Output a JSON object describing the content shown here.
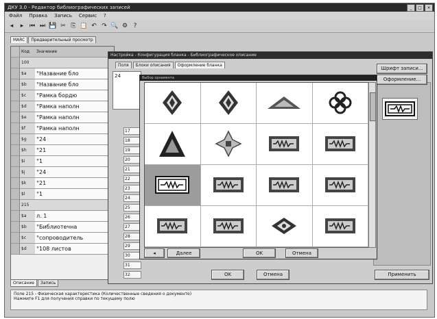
{
  "window": {
    "title": "ДКУ 3.0 - Редактор библиографических записей"
  },
  "menu": [
    "Файл",
    "Правка",
    "Запись",
    "Сервис",
    "?"
  ],
  "toolbar": [
    "◂",
    "▸",
    "⏮",
    "⏭",
    "💾",
    "✂",
    "⎘",
    "📋",
    "↶",
    "↷",
    "🔍",
    "⚙",
    "?"
  ],
  "main_tabs": [
    "MARC",
    "Предварительный просмотр"
  ],
  "grid": {
    "header": {
      "c1": "Код",
      "c2": "Значение"
    },
    "rows": [
      {
        "c1": "100",
        "c2": "",
        "section": true
      },
      {
        "c1": "$a",
        "c2": "°Название бло"
      },
      {
        "c1": "$b",
        "c2": "°Название бло"
      },
      {
        "c1": "$c",
        "c2": "°Рамка бордю"
      },
      {
        "c1": "$d",
        "c2": "°Рамка наполн"
      },
      {
        "c1": "$e",
        "c2": "°Рамка наполн"
      },
      {
        "c1": "$f",
        "c2": "°Рамка наполн"
      },
      {
        "c1": "$g",
        "c2": "°24"
      },
      {
        "c1": "$h",
        "c2": "°21"
      },
      {
        "c1": "$i",
        "c2": "°1"
      },
      {
        "c1": "$j",
        "c2": "°24"
      },
      {
        "c1": "$k",
        "c2": "°21"
      },
      {
        "c1": "$l",
        "c2": "°1"
      },
      {
        "c1": "215",
        "c2": "",
        "section": true
      },
      {
        "c1": "$a",
        "c2": "л. 1"
      },
      {
        "c1": "$b",
        "c2": "°Библиотечна"
      },
      {
        "c1": "$c",
        "c2": "°сопроводитель"
      },
      {
        "c1": "$d",
        "c2": "°108 листов"
      }
    ]
  },
  "bottom_tabs": [
    "Описание",
    "Запись"
  ],
  "status": {
    "line1": "Поле 215 - Физическая характеристика (Количественные сведения о документе)",
    "line2": "Нажмите F1 для получения справки по текущему полю"
  },
  "dialog_config": {
    "title": "Настройка - Конфигурация бланка - Библиографическое описание",
    "tabs": [
      "Поля",
      "Блоки описания",
      "Оформление бланка"
    ],
    "listbox_value": "24",
    "numbers": [
      "17",
      "18",
      "19",
      "20",
      "21",
      "22",
      "23",
      "24",
      "25",
      "26",
      "27",
      "28",
      "29",
      "30",
      "31",
      "32"
    ],
    "right_buttons": [
      "Шрифт записи...",
      "Оформление..."
    ],
    "ok": "OK",
    "cancel": "Отмена",
    "apply": "Применить"
  },
  "dialog_palette": {
    "title": "Выбор орнамента",
    "selected_index": 8,
    "shapes": [
      "diamond",
      "diamond",
      "triangle",
      "cross",
      "triangle-big",
      "snowflake",
      "rect",
      "rect",
      "rect-frame",
      "rect",
      "rect",
      "rect",
      "rect",
      "rect",
      "diamond-small",
      "rect"
    ],
    "buttons": [
      "◂",
      "Далее",
      "OK",
      "Отмена"
    ]
  }
}
